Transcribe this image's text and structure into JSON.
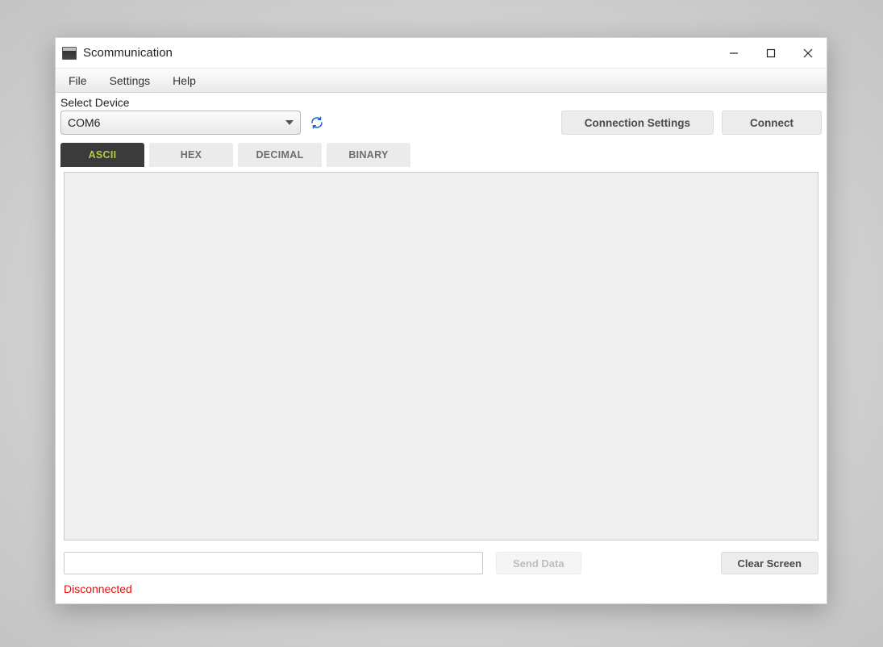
{
  "window": {
    "title": "Scommunication"
  },
  "menu": {
    "items": [
      "File",
      "Settings",
      "Help"
    ]
  },
  "device": {
    "label": "Select Device",
    "selected": "COM6"
  },
  "buttons": {
    "connection_settings": "Connection Settings",
    "connect": "Connect",
    "send_data": "Send Data",
    "clear_screen": "Clear Screen"
  },
  "tabs": {
    "items": [
      "ASCII",
      "HEX",
      "DECIMAL",
      "BINARY"
    ],
    "active_index": 0
  },
  "input": {
    "value": ""
  },
  "status": {
    "text": "Disconnected",
    "color": "#e11010"
  }
}
